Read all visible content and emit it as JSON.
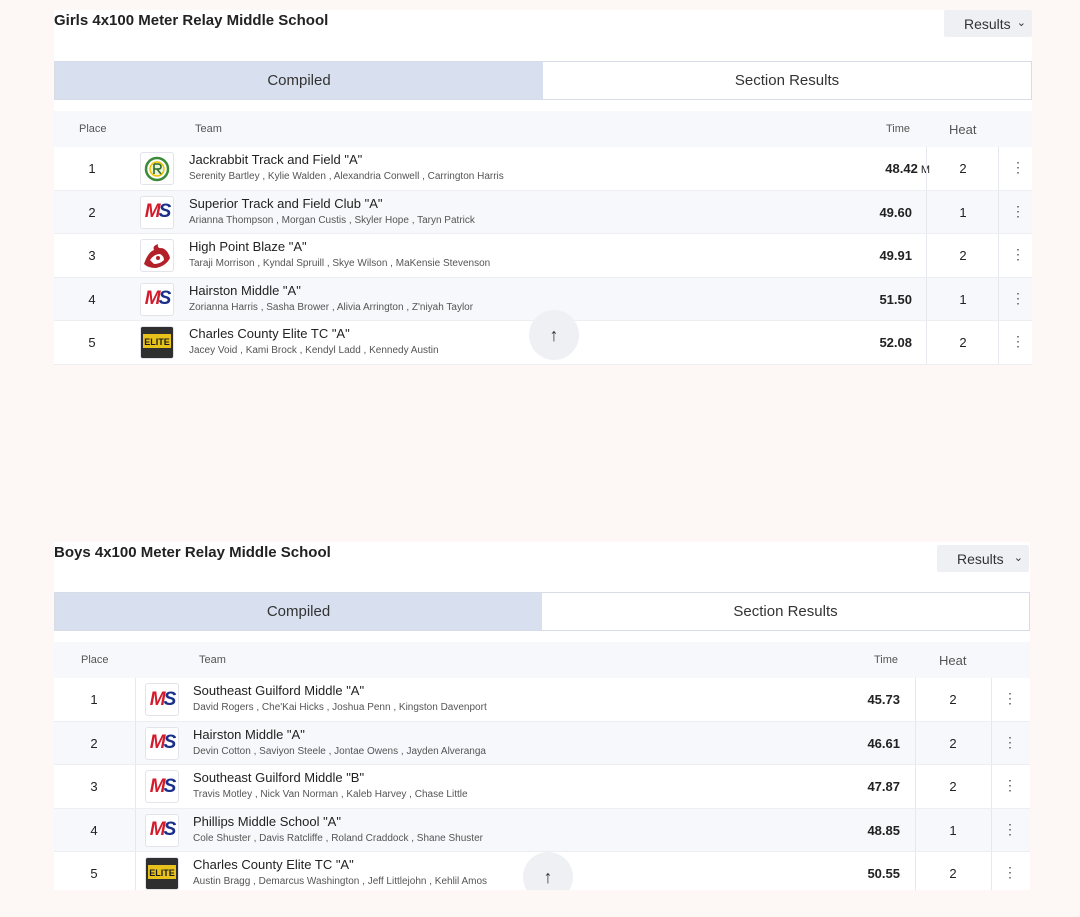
{
  "sections": [
    {
      "title": "Girls 4x100 Meter Relay Middle School",
      "select_value": "Results",
      "tabs": [
        "Compiled",
        "Section Results"
      ],
      "headers": {
        "place": "Place",
        "team": "Team",
        "time": "Time",
        "heat": "Heat"
      },
      "rows": [
        {
          "place": "1",
          "logo": "jackrabbit-logo",
          "team": "Jackrabbit Track and Field \"A\"",
          "athletes": "Serenity Bartley ,  Kylie Walden ,  Alexandria Conwell ,  Carrington Harris",
          "time": "48.42",
          "mark": "M",
          "heat": "2"
        },
        {
          "place": "2",
          "logo": "ms-logo",
          "team": "Superior Track and Field Club \"A\"",
          "athletes": "Arianna Thompson ,  Morgan Custis ,  Skyler Hope ,  Taryn Patrick",
          "time": "49.60",
          "mark": "",
          "heat": "1"
        },
        {
          "place": "3",
          "logo": "blaze-logo",
          "team": "High Point Blaze \"A\"",
          "athletes": "Taraji Morrison ,  Kyndal Spruill ,  Skye Wilson ,  MaKensie Stevenson",
          "time": "49.91",
          "mark": "",
          "heat": "2"
        },
        {
          "place": "4",
          "logo": "ms-logo",
          "team": "Hairston Middle \"A\"",
          "athletes": "Zorianna Harris ,  Sasha Brower ,  Alivia Arrington ,  Z'niyah Taylor",
          "time": "51.50",
          "mark": "",
          "heat": "1"
        },
        {
          "place": "5",
          "logo": "elite-logo",
          "team": "Charles County Elite TC \"A\"",
          "athletes": "Jacey Void ,  Kami Brock ,  Kendyl Ladd ,  Kennedy Austin",
          "time": "52.08",
          "mark": "",
          "heat": "2"
        }
      ]
    },
    {
      "title": "Boys 4x100 Meter Relay Middle School",
      "select_value": "Results",
      "tabs": [
        "Compiled",
        "Section Results"
      ],
      "headers": {
        "place": "Place",
        "team": "Team",
        "time": "Time",
        "heat": "Heat"
      },
      "rows": [
        {
          "place": "1",
          "logo": "ms-logo",
          "team": "Southeast Guilford Middle \"A\"",
          "athletes": "David Rogers ,  Che'Kai Hicks ,  Joshua Penn ,  Kingston Davenport",
          "time": "45.73",
          "mark": "",
          "heat": "2"
        },
        {
          "place": "2",
          "logo": "ms-logo",
          "team": "Hairston Middle \"A\"",
          "athletes": "Devin Cotton ,  Saviyon Steele ,  Jontae Owens ,  Jayden Alveranga",
          "time": "46.61",
          "mark": "",
          "heat": "2"
        },
        {
          "place": "3",
          "logo": "ms-logo",
          "team": "Southeast Guilford Middle \"B\"",
          "athletes": "Travis Motley ,  Nick Van Norman ,  Kaleb Harvey ,  Chase Little",
          "time": "47.87",
          "mark": "",
          "heat": "2"
        },
        {
          "place": "4",
          "logo": "ms-logo",
          "team": "Phillips Middle School \"A\"",
          "athletes": "Cole Shuster ,  Davis Ratcliffe ,  Roland Craddock ,  Shane Shuster",
          "time": "48.85",
          "mark": "",
          "heat": "1"
        },
        {
          "place": "5",
          "logo": "elite-logo",
          "team": "Charles County Elite TC \"A\"",
          "athletes": "Austin Bragg ,  Demarcus Washington ,  Jeff Littlejohn ,  Kehlil Amos",
          "time": "50.55",
          "mark": "",
          "heat": "2"
        }
      ]
    }
  ],
  "icons": {
    "select": "chevron-down-icon",
    "scroll_top": "arrow-up-icon",
    "row_menu": "kebab-menu-icon"
  },
  "logo_text": {
    "ms": [
      "M",
      "S"
    ],
    "elite": "ELITE"
  },
  "glyphs": {
    "chevron": "⌄",
    "kebab": "⋮",
    "arrow_up": "↑"
  }
}
